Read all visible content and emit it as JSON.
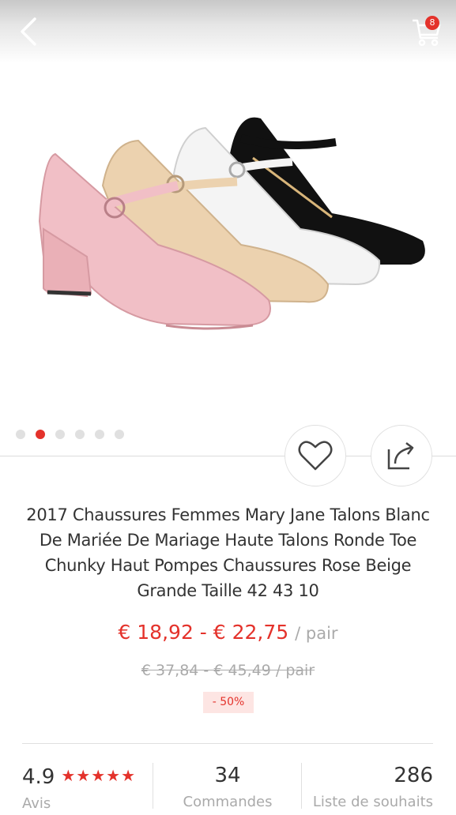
{
  "header": {
    "back_icon": "chevron-left-icon",
    "cart_icon": "cart-icon",
    "cart_count": "8"
  },
  "gallery": {
    "image_alt": "shoes",
    "dots_total": 6,
    "active_index": 1
  },
  "actions": {
    "wishlist_icon": "heart-icon",
    "share_icon": "share-icon"
  },
  "product": {
    "title": "2017 Chaussures Femmes Mary Jane Talons Blanc De Mariée De Mariage Haute Talons Ronde Toe Chunky Haut Pompes Chaussures Rose Beige Grande Taille 42 43 10",
    "price_range": "€ 18,92 - € 22,75",
    "price_unit": "/ pair",
    "old_price": "€ 37,84 - € 45,49 / pair",
    "discount": "- 50%"
  },
  "stats": {
    "rating": "4.9",
    "stars": "★★★★★",
    "rating_label": "Avis",
    "orders": "34",
    "orders_label": "Commandes",
    "wishlist": "286",
    "wishlist_label": "Liste de souhaits"
  },
  "colors": {
    "accent": "#e4322b",
    "muted": "#aaaaaa"
  }
}
